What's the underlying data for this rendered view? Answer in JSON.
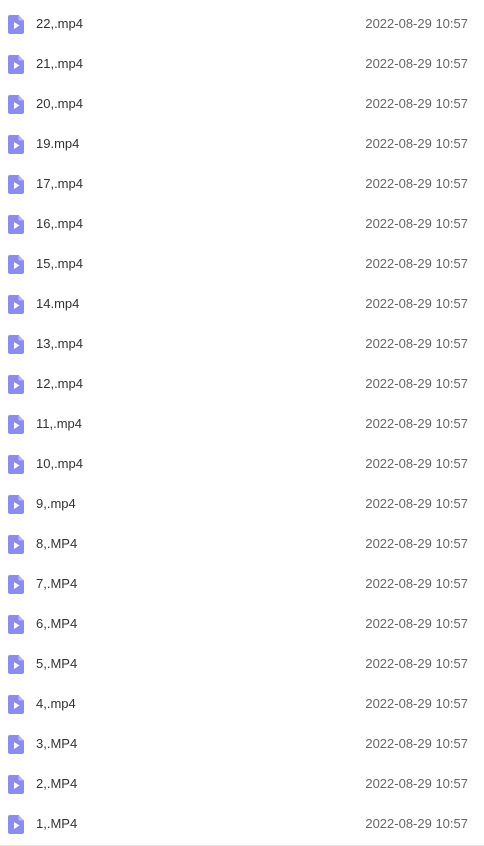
{
  "icon": "video-file-icon",
  "icon_color": "#8B8CF2",
  "files": [
    {
      "name": "22,.mp4",
      "modified": "2022-08-29 10:57"
    },
    {
      "name": "21,.mp4",
      "modified": "2022-08-29 10:57"
    },
    {
      "name": "20,.mp4",
      "modified": "2022-08-29 10:57"
    },
    {
      "name": "19.mp4",
      "modified": "2022-08-29 10:57"
    },
    {
      "name": "17,.mp4",
      "modified": "2022-08-29 10:57"
    },
    {
      "name": "16,.mp4",
      "modified": "2022-08-29 10:57"
    },
    {
      "name": "15,.mp4",
      "modified": "2022-08-29 10:57"
    },
    {
      "name": "14.mp4",
      "modified": "2022-08-29 10:57"
    },
    {
      "name": "13,.mp4",
      "modified": "2022-08-29 10:57"
    },
    {
      "name": "12,.mp4",
      "modified": "2022-08-29 10:57"
    },
    {
      "name": "11,.mp4",
      "modified": "2022-08-29 10:57"
    },
    {
      "name": "10,.mp4",
      "modified": "2022-08-29 10:57"
    },
    {
      "name": "9,.mp4",
      "modified": "2022-08-29 10:57"
    },
    {
      "name": "8,.MP4",
      "modified": "2022-08-29 10:57"
    },
    {
      "name": "7,.MP4",
      "modified": "2022-08-29 10:57"
    },
    {
      "name": "6,.MP4",
      "modified": "2022-08-29 10:57"
    },
    {
      "name": "5,.MP4",
      "modified": "2022-08-29 10:57"
    },
    {
      "name": "4,.mp4",
      "modified": "2022-08-29 10:57"
    },
    {
      "name": "3,.MP4",
      "modified": "2022-08-29 10:57"
    },
    {
      "name": "2,.MP4",
      "modified": "2022-08-29 10:57"
    },
    {
      "name": "1,.MP4",
      "modified": "2022-08-29 10:57"
    }
  ]
}
